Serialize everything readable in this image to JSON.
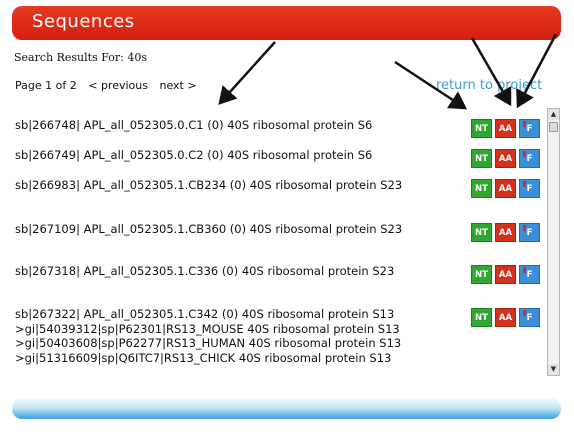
{
  "header": {
    "title": "Sequences"
  },
  "search": {
    "label": "Search Results For: 40s"
  },
  "pager": {
    "page_text": "Page 1 of 2",
    "previous": "< previous",
    "next": "next >"
  },
  "return_link": "return to project",
  "buttons": {
    "nt": "NT",
    "aa": "AA",
    "f": "F"
  },
  "results": [
    {
      "text": "sb|266748| APL_all_052305.0.C1 (0) 40S ribosomal protein S6"
    },
    {
      "text": "sb|266749| APL_all_052305.0.C2 (0) 40S ribosomal protein S6"
    },
    {
      "text": "sb|266983| APL_all_052305.1.CB234 (0) 40S ribosomal protein S23"
    },
    {
      "text": "sb|267109| APL_all_052305.1.CB360 (0) 40S ribosomal protein S23"
    },
    {
      "text": "sb|267318| APL_all_052305.1.C336 (0) 40S ribosomal protein S23"
    },
    {
      "text": "sb|267322| APL_all_052305.1.C342 (0) 40S ribosomal protein S13 >gi|54039312|sp|P62301|RS13_MOUSE 40S ribosomal protein S13 >gi|50403608|sp|P62277|RS13_HUMAN 40S ribosomal protein S13 >gi|51316609|sp|Q6ITC7|RS13_CHICK 40S ribosomal protein S13"
    }
  ],
  "colors": {
    "header": "#e02a14",
    "nt": "#2fa82f",
    "aa": "#d4301e",
    "f": "#3b8fd8",
    "link": "#3a9bd0"
  }
}
